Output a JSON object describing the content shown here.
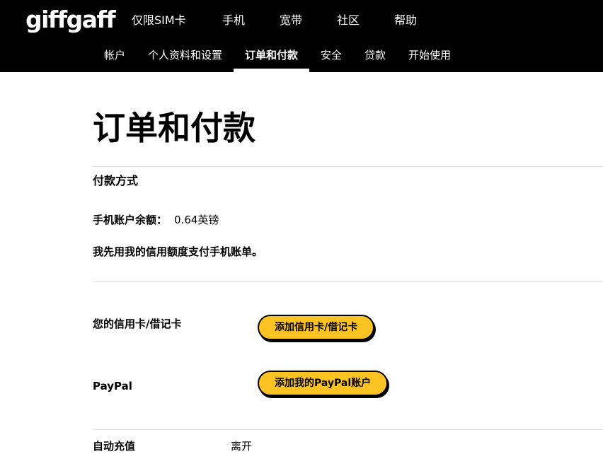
{
  "header": {
    "logo": "giffgaff",
    "main_nav": [
      {
        "label": "仅限SIM卡"
      },
      {
        "label": "手机"
      },
      {
        "label": "宽带"
      },
      {
        "label": "社区"
      },
      {
        "label": "帮助"
      }
    ],
    "sub_nav": [
      {
        "label": "帐户"
      },
      {
        "label": "个人资料和设置"
      },
      {
        "label": "订单和付款",
        "active": true
      },
      {
        "label": "安全"
      },
      {
        "label": "贷款"
      },
      {
        "label": "开始使用"
      }
    ]
  },
  "page": {
    "title": "订单和付款"
  },
  "payment": {
    "section_title": "付款方式",
    "balance_label": "手机账户余额：",
    "balance_value": "0.64英镑",
    "credit_note": "我先用我的信用额度支付手机账单。",
    "card": {
      "label": "您的信用卡/借记卡",
      "button": "添加信用卡/借记卡"
    },
    "paypal": {
      "label": "PayPal",
      "button": "添加我的PayPal账户"
    },
    "auto_topup": {
      "label": "自动充值",
      "value": "离开"
    }
  },
  "colors": {
    "header_bg": "#000000",
    "button_yellow": "#fdc323",
    "divider": "#dcdcdc"
  }
}
